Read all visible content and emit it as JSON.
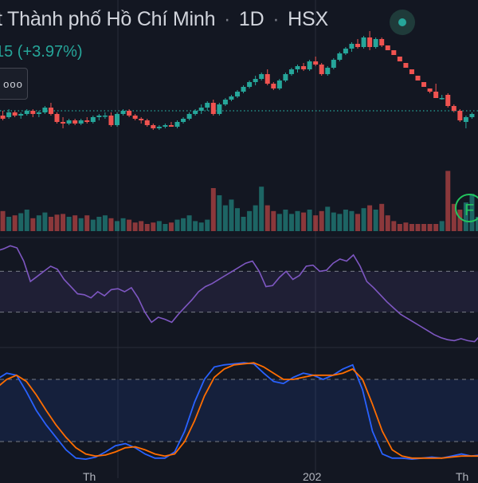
{
  "header": {
    "title_fragment": "t Thành phố Hồ Chí Minh",
    "interval": "1D",
    "exchange": "HSX",
    "separator": "·",
    "price_change_fragment": "15 (+3.97%)",
    "more_button_label": "ooo"
  },
  "colors": {
    "background": "#131722",
    "up": "#26a69a",
    "down": "#ef5350",
    "rsi_line": "#7e57c2",
    "stoch_k": "#2962ff",
    "stoch_d": "#ff6d00",
    "grid": "#2a2e39"
  },
  "icons": {
    "live_indicator": "live-dot-icon",
    "flag_badge": "flag-badge-icon",
    "more_button": "more-dots-icon"
  },
  "flag_badge_text": "F",
  "axis": {
    "x_labels": [
      "Th",
      "202",
      "Th"
    ]
  },
  "chart_data": [
    {
      "type": "candlestick",
      "title": "",
      "xlabel": "",
      "ylabel": "",
      "y_range": [
        0,
        100
      ],
      "reference_line": 48,
      "candles": [
        {
          "o": 42,
          "h": 46,
          "l": 39,
          "c": 45
        },
        {
          "o": 45,
          "h": 48,
          "l": 42,
          "c": 43
        },
        {
          "o": 44,
          "h": 49,
          "l": 43,
          "c": 47
        },
        {
          "o": 47,
          "h": 48,
          "l": 44,
          "c": 45
        },
        {
          "o": 45,
          "h": 47,
          "l": 43,
          "c": 46
        },
        {
          "o": 46,
          "h": 49,
          "l": 45,
          "c": 48
        },
        {
          "o": 48,
          "h": 49,
          "l": 44,
          "c": 46
        },
        {
          "o": 46,
          "h": 48,
          "l": 44,
          "c": 47
        },
        {
          "o": 47,
          "h": 51,
          "l": 46,
          "c": 50
        },
        {
          "o": 50,
          "h": 53,
          "l": 45,
          "c": 46
        },
        {
          "o": 46,
          "h": 47,
          "l": 40,
          "c": 41
        },
        {
          "o": 41,
          "h": 44,
          "l": 37,
          "c": 40
        },
        {
          "o": 40,
          "h": 43,
          "l": 39,
          "c": 42
        },
        {
          "o": 42,
          "h": 43,
          "l": 39,
          "c": 40
        },
        {
          "o": 40,
          "h": 43,
          "l": 39,
          "c": 42
        },
        {
          "o": 42,
          "h": 44,
          "l": 40,
          "c": 41
        },
        {
          "o": 41,
          "h": 45,
          "l": 40,
          "c": 44
        },
        {
          "o": 44,
          "h": 46,
          "l": 42,
          "c": 45
        },
        {
          "o": 45,
          "h": 47,
          "l": 43,
          "c": 45
        },
        {
          "o": 45,
          "h": 47,
          "l": 38,
          "c": 39
        },
        {
          "o": 39,
          "h": 47,
          "l": 38,
          "c": 46
        },
        {
          "o": 46,
          "h": 49,
          "l": 45,
          "c": 48
        },
        {
          "o": 48,
          "h": 49,
          "l": 44,
          "c": 45
        },
        {
          "o": 45,
          "h": 46,
          "l": 42,
          "c": 43
        },
        {
          "o": 43,
          "h": 44,
          "l": 40,
          "c": 42
        },
        {
          "o": 42,
          "h": 43,
          "l": 38,
          "c": 39
        },
        {
          "o": 39,
          "h": 40,
          "l": 36,
          "c": 37
        },
        {
          "o": 37,
          "h": 39,
          "l": 36,
          "c": 38
        },
        {
          "o": 38,
          "h": 40,
          "l": 37,
          "c": 39
        },
        {
          "o": 39,
          "h": 41,
          "l": 38,
          "c": 38
        },
        {
          "o": 38,
          "h": 42,
          "l": 37,
          "c": 41
        },
        {
          "o": 41,
          "h": 44,
          "l": 40,
          "c": 43
        },
        {
          "o": 43,
          "h": 47,
          "l": 42,
          "c": 46
        },
        {
          "o": 46,
          "h": 49,
          "l": 45,
          "c": 48
        },
        {
          "o": 48,
          "h": 52,
          "l": 46,
          "c": 50
        },
        {
          "o": 50,
          "h": 54,
          "l": 48,
          "c": 53
        },
        {
          "o": 53,
          "h": 55,
          "l": 45,
          "c": 46
        },
        {
          "o": 46,
          "h": 53,
          "l": 45,
          "c": 52
        },
        {
          "o": 52,
          "h": 56,
          "l": 51,
          "c": 55
        },
        {
          "o": 55,
          "h": 58,
          "l": 54,
          "c": 57
        },
        {
          "o": 57,
          "h": 61,
          "l": 56,
          "c": 60
        },
        {
          "o": 60,
          "h": 64,
          "l": 59,
          "c": 63
        },
        {
          "o": 63,
          "h": 67,
          "l": 62,
          "c": 66
        },
        {
          "o": 66,
          "h": 70,
          "l": 64,
          "c": 68
        },
        {
          "o": 68,
          "h": 72,
          "l": 67,
          "c": 71
        },
        {
          "o": 71,
          "h": 74,
          "l": 64,
          "c": 65
        },
        {
          "o": 65,
          "h": 66,
          "l": 61,
          "c": 62
        },
        {
          "o": 62,
          "h": 68,
          "l": 61,
          "c": 67
        },
        {
          "o": 67,
          "h": 72,
          "l": 66,
          "c": 71
        },
        {
          "o": 71,
          "h": 75,
          "l": 70,
          "c": 74
        },
        {
          "o": 74,
          "h": 77,
          "l": 72,
          "c": 76
        },
        {
          "o": 76,
          "h": 78,
          "l": 73,
          "c": 74
        },
        {
          "o": 74,
          "h": 80,
          "l": 73,
          "c": 79
        },
        {
          "o": 79,
          "h": 82,
          "l": 76,
          "c": 77
        },
        {
          "o": 77,
          "h": 78,
          "l": 70,
          "c": 71
        },
        {
          "o": 71,
          "h": 76,
          "l": 70,
          "c": 75
        },
        {
          "o": 75,
          "h": 81,
          "l": 74,
          "c": 80
        },
        {
          "o": 80,
          "h": 85,
          "l": 79,
          "c": 84
        },
        {
          "o": 84,
          "h": 88,
          "l": 83,
          "c": 87
        },
        {
          "o": 87,
          "h": 91,
          "l": 85,
          "c": 90
        },
        {
          "o": 90,
          "h": 93,
          "l": 87,
          "c": 88
        },
        {
          "o": 88,
          "h": 95,
          "l": 87,
          "c": 94
        },
        {
          "o": 94,
          "h": 98,
          "l": 86,
          "c": 88
        },
        {
          "o": 88,
          "h": 94,
          "l": 87,
          "c": 93
        },
        {
          "o": 93,
          "h": 94,
          "l": 88,
          "c": 89
        },
        {
          "o": 89,
          "h": 89,
          "l": 86,
          "c": 86
        },
        {
          "o": 86,
          "h": 86,
          "l": 83,
          "c": 83
        },
        {
          "o": 82,
          "h": 82,
          "l": 79,
          "c": 79
        },
        {
          "o": 78,
          "h": 78,
          "l": 75,
          "c": 75
        },
        {
          "o": 74,
          "h": 74,
          "l": 71,
          "c": 71
        },
        {
          "o": 70,
          "h": 70,
          "l": 67,
          "c": 67
        },
        {
          "o": 66,
          "h": 66,
          "l": 63,
          "c": 63
        },
        {
          "o": 62,
          "h": 62,
          "l": 59,
          "c": 60
        },
        {
          "o": 60,
          "h": 65,
          "l": 56,
          "c": 56
        },
        {
          "o": 56,
          "h": 58,
          "l": 55,
          "c": 56
        },
        {
          "o": 58,
          "h": 59,
          "l": 50,
          "c": 51
        },
        {
          "o": 51,
          "h": 52,
          "l": 47,
          "c": 48
        },
        {
          "o": 48,
          "h": 49,
          "l": 41,
          "c": 42
        },
        {
          "o": 41,
          "h": 45,
          "l": 37,
          "c": 44
        },
        {
          "o": 44,
          "h": 47,
          "l": 43,
          "c": 46
        }
      ],
      "volume": [
        12,
        28,
        20,
        22,
        25,
        30,
        18,
        22,
        26,
        20,
        23,
        24,
        20,
        22,
        18,
        22,
        16,
        20,
        22,
        18,
        14,
        18,
        16,
        12,
        14,
        10,
        12,
        14,
        10,
        12,
        16,
        18,
        22,
        14,
        12,
        16,
        60,
        50,
        36,
        44,
        32,
        20,
        28,
        36,
        62,
        36,
        28,
        24,
        30,
        24,
        28,
        26,
        30,
        22,
        28,
        34,
        26,
        24,
        30,
        28,
        24,
        32,
        36,
        30,
        38,
        22,
        14,
        10,
        12,
        10,
        10,
        10,
        10,
        10,
        14,
        84,
        38,
        30,
        40,
        52,
        20,
        30
      ]
    },
    {
      "type": "line",
      "title": "",
      "xlabel": "",
      "ylabel": "",
      "y_range": [
        0,
        100
      ],
      "bands": [
        70,
        30
      ],
      "series": [
        {
          "values": [
            90,
            92,
            95,
            93,
            80,
            60,
            65,
            70,
            75,
            72,
            62,
            55,
            48,
            47,
            44,
            50,
            46,
            52,
            53,
            50,
            54,
            44,
            30,
            20,
            25,
            23,
            20,
            28,
            35,
            42,
            50,
            55,
            58,
            62,
            66,
            70,
            74,
            78,
            80,
            70,
            55,
            56,
            64,
            70,
            62,
            66,
            75,
            76,
            70,
            71,
            78,
            82,
            80,
            86,
            75,
            60,
            54,
            47,
            40,
            34,
            28,
            24,
            20,
            16,
            12,
            8,
            5,
            3,
            2,
            4,
            2,
            1,
            8
          ]
        }
      ]
    },
    {
      "type": "line",
      "title": "",
      "xlabel": "",
      "ylabel": "",
      "y_range": [
        0,
        100
      ],
      "bands": [
        80,
        20
      ],
      "series": [
        {
          "values": [
            80,
            86,
            84,
            68,
            50,
            36,
            24,
            12,
            4,
            3,
            5,
            10,
            16,
            18,
            14,
            8,
            4,
            4,
            10,
            30,
            58,
            80,
            92,
            94,
            95,
            96,
            95,
            86,
            78,
            76,
            82,
            86,
            84,
            80,
            84,
            90,
            94,
            70,
            30,
            8,
            4,
            4,
            3,
            4,
            5,
            4,
            6,
            8,
            6,
            7
          ]
        },
        {
          "values": [
            72,
            80,
            84,
            78,
            65,
            50,
            36,
            24,
            14,
            8,
            6,
            7,
            10,
            14,
            15,
            12,
            8,
            6,
            8,
            20,
            40,
            64,
            82,
            90,
            94,
            95,
            96,
            92,
            86,
            80,
            80,
            82,
            84,
            84,
            84,
            86,
            90,
            80,
            56,
            30,
            12,
            6,
            4,
            4,
            4,
            4,
            5,
            6,
            6,
            6
          ]
        }
      ]
    }
  ]
}
